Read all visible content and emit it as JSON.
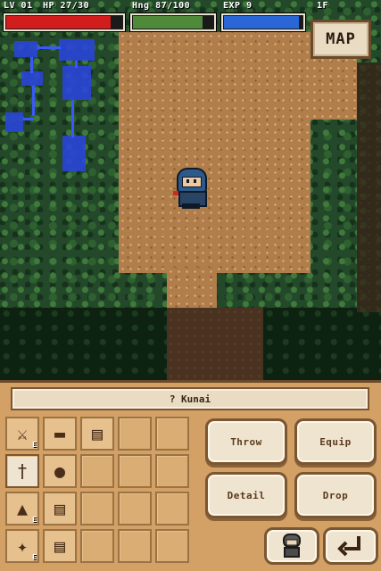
{
  "hud": {
    "level_text": "LV 01",
    "hp_text": "HP 27/30",
    "hunger_text": "Hng 87/100",
    "exp_text": "EXP 9",
    "floor_text": "1F",
    "hp_fraction": 0.9,
    "hunger_fraction": 0.87,
    "exp_fraction": 0.95,
    "colors": {
      "hp": "#d21d1d",
      "hunger": "#4e8a3a",
      "exp": "#2a66d6"
    }
  },
  "map_button": {
    "label": "MAP"
  },
  "selected_item": {
    "label": "? Kunai"
  },
  "inventory": {
    "slots": [
      {
        "icon": "sword-icon",
        "equipped": true
      },
      {
        "icon": "bread-icon",
        "equipped": false
      },
      {
        "icon": "scroll-icon",
        "equipped": false
      },
      {
        "icon": "",
        "equipped": false
      },
      {
        "icon": "",
        "equipped": false
      },
      {
        "icon": "kunai-icon",
        "equipped": false,
        "selected": true
      },
      {
        "icon": "pot-icon",
        "equipped": false
      },
      {
        "icon": "",
        "equipped": false
      },
      {
        "icon": "",
        "equipped": false
      },
      {
        "icon": "",
        "equipped": false
      },
      {
        "icon": "armor-icon",
        "equipped": true
      },
      {
        "icon": "scroll-icon",
        "equipped": false
      },
      {
        "icon": "",
        "equipped": false
      },
      {
        "icon": "",
        "equipped": false
      },
      {
        "icon": "",
        "equipped": false
      },
      {
        "icon": "shuriken-icon",
        "equipped": true
      },
      {
        "icon": "scroll-icon",
        "equipped": false
      },
      {
        "icon": "",
        "equipped": false
      },
      {
        "icon": "",
        "equipped": false
      },
      {
        "icon": "",
        "equipped": false
      }
    ],
    "equipped_mark": "E"
  },
  "actions": {
    "throw_label": "Throw",
    "equip_label": "Equip",
    "detail_label": "Detail",
    "drop_label": "Drop"
  },
  "icons": {
    "character_button": "character-icon",
    "back_button": "back-arrow-icon"
  }
}
